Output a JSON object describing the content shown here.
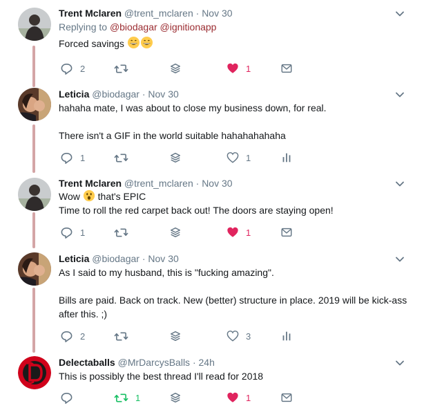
{
  "tweets": [
    {
      "name": "Trent Mclaren",
      "handle": "@trent_mclaren",
      "time": "Nov 30",
      "reply_prefix": "Replying to",
      "reply_to_1": "@biodagar",
      "reply_to_2": "@ignitionapp",
      "text1": "Forced savings",
      "reply_count": "2",
      "like_count": "1"
    },
    {
      "name": "Leticia",
      "handle": "@biodagar",
      "time": "Nov 30",
      "text1": "hahaha mate, I was about to close my business down, for real.",
      "text2": "There isn't a GIF in the world suitable hahahahahaha",
      "reply_count": "1",
      "like_count": "1"
    },
    {
      "name": "Trent Mclaren",
      "handle": "@trent_mclaren",
      "time": "Nov 30",
      "text1a": "Wow",
      "text1b": "that's EPIC",
      "text2": "Time to roll the red carpet back out! The doors are staying open!",
      "reply_count": "1",
      "like_count": "1"
    },
    {
      "name": "Leticia",
      "handle": "@biodagar",
      "time": "Nov 30",
      "text1": "As I said to my husband, this is \"fucking amazing\".",
      "text2": "Bills are paid. Back on track. New (better) structure in place. 2019 will be kick-ass after this. ;)",
      "reply_count": "2",
      "like_count": "3"
    },
    {
      "name": "Delectaballs",
      "handle": "@MrDarcysBalls",
      "time": "24h",
      "text1": "This is possibly the best thread I'll read for 2018",
      "retweet_count": "1",
      "like_count": "1"
    }
  ],
  "colors": {
    "thread_line": "#d4a5a6",
    "like_active": "#e0245e",
    "retweet_active": "#17bf63",
    "reply_link": "#9b2c31",
    "muted": "#657786"
  }
}
